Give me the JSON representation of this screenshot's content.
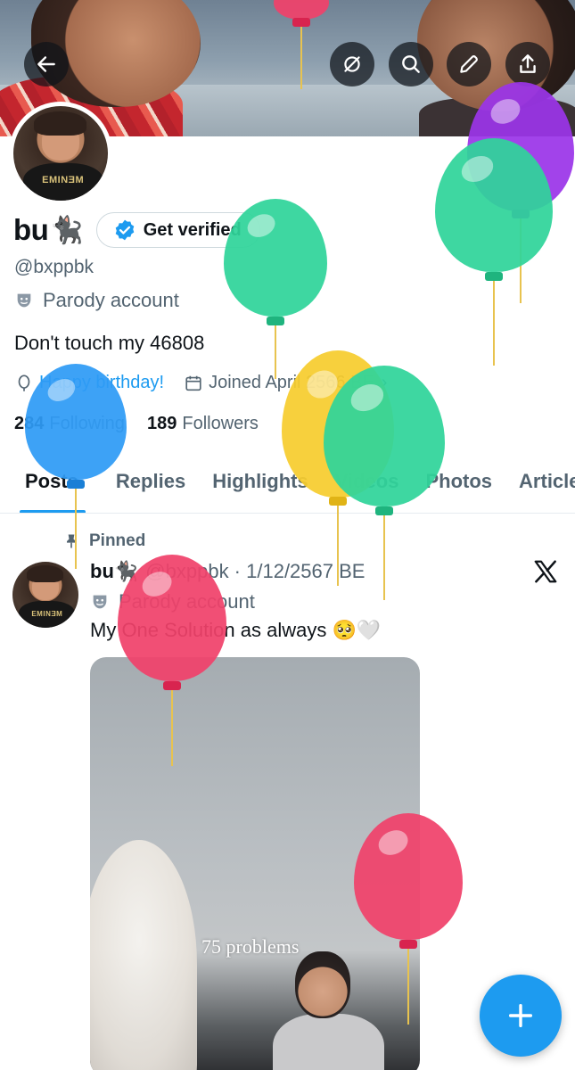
{
  "header": {
    "back_label": "back",
    "incognito_label": "hidden",
    "search_label": "search",
    "edit_label": "edit",
    "share_label": "share"
  },
  "profile": {
    "name": "bu",
    "name_emoji": "🐈‍⬛",
    "verify_label": "Get verified",
    "handle": "@bxppbk",
    "parody_label": "Parody account",
    "bio": "Don't touch my 46808",
    "birthday": "Happy birthday!",
    "joined": "Joined April 2566 BE",
    "following_count": "284",
    "following_label": "Following",
    "followers_count": "189",
    "followers_label": "Followers"
  },
  "tabs": [
    {
      "label": "Posts",
      "active": true
    },
    {
      "label": "Replies",
      "active": false
    },
    {
      "label": "Highlights",
      "active": false
    },
    {
      "label": "Videos",
      "active": false
    },
    {
      "label": "Photos",
      "active": false
    },
    {
      "label": "Articles",
      "active": false
    }
  ],
  "post": {
    "pinned_label": "Pinned",
    "author_name": "bu",
    "author_emoji": "🐈‍⬛",
    "author_meta": "@bxppbk · 1/12/2567 BE",
    "parody_label": "Parody account",
    "text": "My One Solution as always 🥺🤍",
    "media_subtitle": "75 problems",
    "avatar_shirt_text": "EMINƎM"
  },
  "colors": {
    "accent": "#1d9bf0",
    "secondary_text": "#536471",
    "primary_text": "#0f1419"
  }
}
